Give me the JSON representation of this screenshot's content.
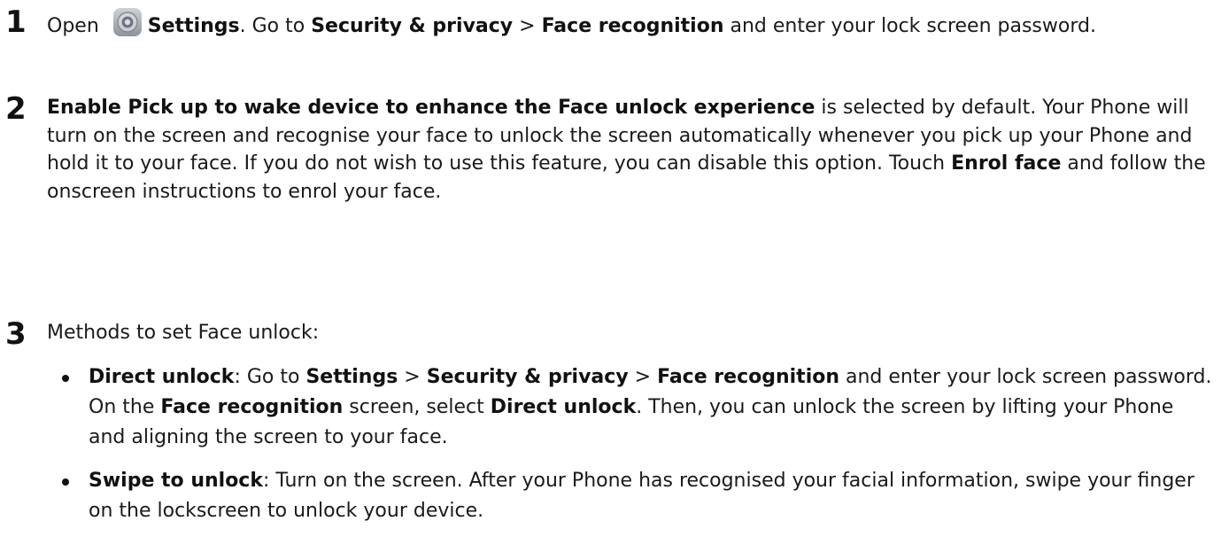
{
  "steps": [
    {
      "number": "1",
      "parts": [
        {
          "t": "Open "
        },
        {
          "icon": "settings-icon"
        },
        {
          "t": "Settings",
          "b": true
        },
        {
          "t": ". Go to "
        },
        {
          "t": "Security & privacy",
          "b": true
        },
        {
          "t": " > "
        },
        {
          "t": "Face recognition",
          "b": true
        },
        {
          "t": " and enter your lock screen password."
        }
      ]
    },
    {
      "number": "2",
      "parts": [
        {
          "t": "Enable Pick up to wake device to enhance the Face unlock experience",
          "b": true
        },
        {
          "t": " is selected by default. Your Phone will turn on the screen and recognise your face to unlock the screen automatically whenever you pick up your Phone and hold it to your face. If you do not wish to use this feature, you can disable this option. Touch "
        },
        {
          "t": "Enrol face",
          "b": true
        },
        {
          "t": " and follow the onscreen instructions to enrol your face."
        }
      ]
    },
    {
      "number": "3",
      "parts": [
        {
          "t": "Methods to set Face unlock:"
        }
      ]
    }
  ],
  "bullets": [
    {
      "parts": [
        {
          "t": "Direct unlock",
          "b": true
        },
        {
          "t": ": Go to "
        },
        {
          "t": "Settings",
          "b": true
        },
        {
          "t": " > "
        },
        {
          "t": "Security & privacy",
          "b": true
        },
        {
          "t": " > "
        },
        {
          "t": "Face recognition",
          "b": true
        },
        {
          "t": " and enter your lock screen password. On the "
        },
        {
          "t": "Face recognition",
          "b": true
        },
        {
          "t": " screen, select "
        },
        {
          "t": "Direct unlock",
          "b": true
        },
        {
          "t": ". Then, you can unlock the screen by lifting your Phone and aligning the screen to your face."
        }
      ]
    },
    {
      "parts": [
        {
          "t": "Swipe to unlock",
          "b": true
        },
        {
          "t": ": Turn on the screen. After your Phone has recognised your facial information, swipe your finger on the lockscreen to unlock your device."
        }
      ]
    }
  ]
}
